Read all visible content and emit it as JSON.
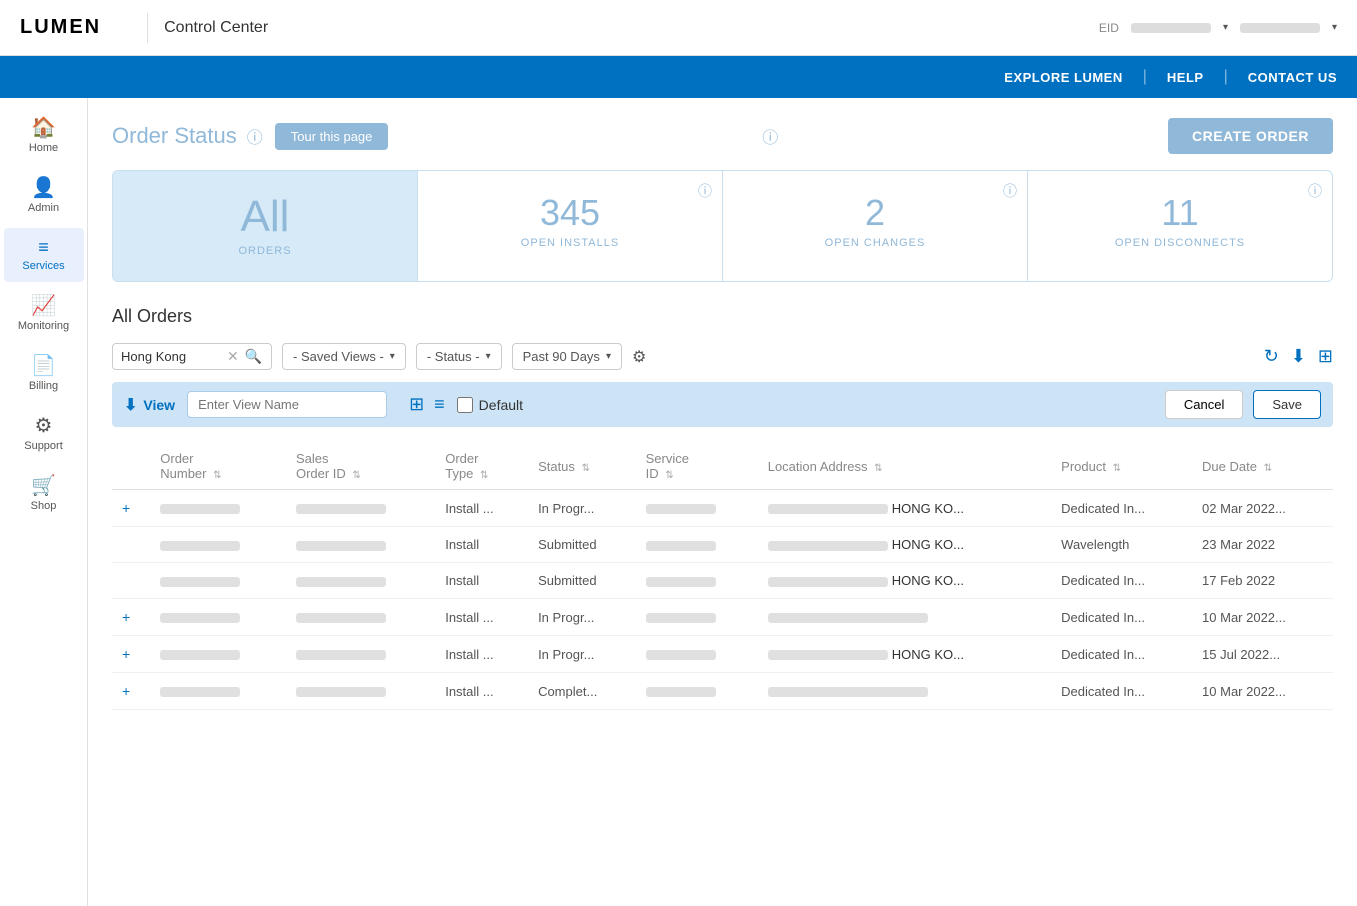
{
  "header": {
    "logo": "LUMEN",
    "title": "Control Center",
    "eid_label": "EID",
    "nav_links": [
      "EXPLORE LUMEN",
      "HELP",
      "CONTACT US"
    ]
  },
  "sidebar": {
    "items": [
      {
        "id": "home",
        "label": "Home",
        "icon": "🏠",
        "active": false
      },
      {
        "id": "admin",
        "label": "Admin",
        "icon": "👤",
        "active": false
      },
      {
        "id": "services",
        "label": "Services",
        "icon": "☰",
        "active": true
      },
      {
        "id": "monitoring",
        "label": "Monitoring",
        "icon": "📈",
        "active": false
      },
      {
        "id": "billing",
        "label": "Billing",
        "icon": "📄",
        "active": false
      },
      {
        "id": "support",
        "label": "Support",
        "icon": "⚙",
        "active": false
      },
      {
        "id": "shop",
        "label": "Shop",
        "icon": "🛒",
        "active": false
      }
    ]
  },
  "page": {
    "title": "Order Status",
    "tour_btn": "Tour this page",
    "create_order_btn": "CREATE ORDER",
    "section_title": "All Orders"
  },
  "stats": [
    {
      "id": "all",
      "value": "All",
      "label": "ORDERS",
      "active": true
    },
    {
      "id": "installs",
      "value": "345",
      "label": "OPEN INSTALLS",
      "active": false
    },
    {
      "id": "changes",
      "value": "2",
      "label": "OPEN CHANGES",
      "active": false
    },
    {
      "id": "disconnects",
      "value": "11",
      "label": "OPEN DISCONNECTS",
      "active": false
    }
  ],
  "filters": {
    "search_value": "Hong Kong",
    "saved_views_label": "- Saved Views -",
    "status_label": "- Status -",
    "date_label": "Past 90 Days"
  },
  "save_view_bar": {
    "label": "View",
    "input_placeholder": "Enter View Name",
    "default_label": "Default",
    "cancel_btn": "Cancel",
    "save_btn": "Save"
  },
  "table": {
    "columns": [
      {
        "id": "expand",
        "label": ""
      },
      {
        "id": "order_number",
        "label": "Order Number"
      },
      {
        "id": "sales_order_id",
        "label": "Sales Order ID"
      },
      {
        "id": "order_type",
        "label": "Order Type"
      },
      {
        "id": "status",
        "label": "Status"
      },
      {
        "id": "service_id",
        "label": "Service ID"
      },
      {
        "id": "location_address",
        "label": "Location Address"
      },
      {
        "id": "product",
        "label": "Product"
      },
      {
        "id": "due_date",
        "label": "Due Date"
      }
    ],
    "rows": [
      {
        "expand": "+",
        "order_number": "",
        "sales_order_id": "",
        "order_type": "Install ...",
        "status": "In Progr...",
        "service_id": "",
        "location_address": "HONG KO...",
        "product": "Dedicated In...",
        "due_date": "02 Mar 2022..."
      },
      {
        "expand": "",
        "order_number": "",
        "sales_order_id": "",
        "order_type": "Install",
        "status": "Submitted",
        "service_id": "",
        "location_address": "HONG KO...",
        "product": "Wavelength",
        "due_date": "23 Mar 2022"
      },
      {
        "expand": "",
        "order_number": "",
        "sales_order_id": "",
        "order_type": "Install",
        "status": "Submitted",
        "service_id": "",
        "location_address": "HONG KO...",
        "product": "Dedicated In...",
        "due_date": "17 Feb 2022"
      },
      {
        "expand": "+",
        "order_number": "",
        "sales_order_id": "",
        "order_type": "Install ...",
        "status": "In Progr...",
        "service_id": "",
        "location_address": "",
        "product": "Dedicated In...",
        "due_date": "10 Mar 2022..."
      },
      {
        "expand": "+",
        "order_number": "",
        "sales_order_id": "",
        "order_type": "Install ...",
        "status": "In Progr...",
        "service_id": "",
        "location_address": "HONG KO...",
        "product": "Dedicated In...",
        "due_date": "15 Jul 2022..."
      },
      {
        "expand": "+",
        "order_number": "",
        "sales_order_id": "",
        "order_type": "Install ...",
        "status": "Complet...",
        "service_id": "",
        "location_address": "",
        "product": "Dedicated In...",
        "due_date": "10 Mar 2022..."
      }
    ]
  }
}
